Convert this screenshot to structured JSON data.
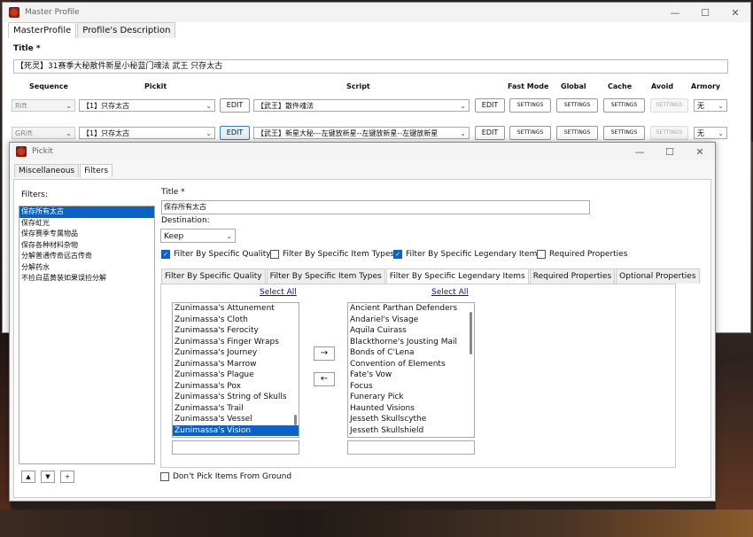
{
  "master": {
    "window_title": "Master Profile",
    "tabs": [
      "MasterProfile",
      "Profile's Description"
    ],
    "title_label": "Title *",
    "title_value": "【死灵】31赛季大秘散件新星小秘蓝门魂法 武王 只存太古",
    "columns": {
      "sequence": "Sequence",
      "pickit": "Pickit",
      "script": "Script",
      "fast_mode": "Fast Mode",
      "global": "Global",
      "cache": "Cache",
      "avoid": "Avoid",
      "armory": "Armory"
    },
    "rows": [
      {
        "sequence": "Rift",
        "pickit": "【1】只存太古",
        "edit": "EDIT",
        "script": "【武王】散件魂法",
        "settings": "SETTINGS",
        "armory": "无"
      },
      {
        "sequence": "GRift",
        "pickit": "【1】只存太古",
        "edit": "EDIT",
        "script": "【武王】新星大秘---左键放新星--左键放新星--左键放新星",
        "settings": "SETTINGS",
        "armory": "无"
      }
    ]
  },
  "window_controls": {
    "minimize": "—",
    "maximize": "☐",
    "close": "✕"
  },
  "pickit": {
    "window_title": "Pickit",
    "tabs": [
      "Miscellaneous",
      "Filters"
    ],
    "filters_label": "Filters:",
    "filters": [
      "保存所有太古",
      "保存虹光",
      "保存赛季专属物品",
      "保存各种材料杂物",
      "分解普通传奇远古传奇",
      "分解药水",
      "不捡白蓝黄装如果误捡分解"
    ],
    "controls": {
      "up": "▲",
      "down": "▼",
      "add": "+"
    },
    "title_label": "Title *",
    "title_value": "保存所有太古",
    "destination_label": "Destination:",
    "destination_value": "Keep",
    "checks": [
      {
        "label": "Filter By Specific Quality",
        "checked": true
      },
      {
        "label": "Filter By Specific Item Types",
        "checked": false
      },
      {
        "label": "Filter By Specific Legendary Items",
        "checked": true
      },
      {
        "label": "Required Properties",
        "checked": false
      }
    ],
    "subtabs": [
      "Filter By Specific Quality",
      "Filter By Specific Item Types",
      "Filter By Specific Legendary Items",
      "Required Properties",
      "Optional Properties"
    ],
    "select_all": "Select All",
    "left_list": [
      "Zunimassa's Attunement",
      "Zunimassa's Cloth",
      "Zunimassa's Ferocity",
      "Zunimassa's Finger Wraps",
      "Zunimassa's Journey",
      "Zunimassa's Marrow",
      "Zunimassa's Plague",
      "Zunimassa's Pox",
      "Zunimassa's String of Skulls",
      "Zunimassa's Trail",
      "Zunimassa's Vessel",
      "Zunimassa's Vision"
    ],
    "right_list": [
      "Ancient Parthan Defenders",
      "Andariel's Visage",
      "Aquila Cuirass",
      "Blackthorne's Jousting Mail",
      "Bonds of C'Lena",
      "Convention of Elements",
      "Fate's Vow",
      "Focus",
      "Funerary Pick",
      "Haunted Visions",
      "Jesseth Skullscythe",
      "Jesseth Skullshield"
    ],
    "move_right": "→",
    "move_left": "←",
    "dont_pick": "Don't Pick Items From Ground"
  }
}
